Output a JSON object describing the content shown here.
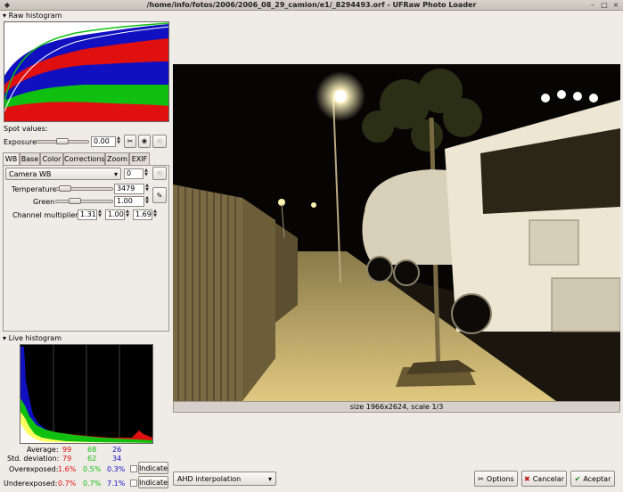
{
  "window": {
    "title": "/home/info/fotos/2006/2006_08_29_camion/e1/_8294493.orf - UFRaw Photo Loader"
  },
  "raw_histogram": {
    "label": "Raw histogram"
  },
  "spot_values": {
    "label": "Spot values:"
  },
  "exposure": {
    "label": "Exposure",
    "value": "0.00"
  },
  "tabs": [
    {
      "label": "WB"
    },
    {
      "label": "Base"
    },
    {
      "label": "Color"
    },
    {
      "label": "Corrections"
    },
    {
      "label": "Zoom"
    },
    {
      "label": "EXIF"
    }
  ],
  "wb": {
    "preset": "Camera WB",
    "fine_tune": "0",
    "temperature_label": "Temperature",
    "temperature": "3479",
    "temperature_level": 0.08,
    "green_label": "Green",
    "green": "1.00",
    "green_level": 0.3,
    "multipliers_label": "Channel multipliers:",
    "multipliers": [
      "1.31",
      "1.00",
      "1.69"
    ]
  },
  "live_histogram": {
    "label": "Live histogram",
    "average_label": "Average:",
    "average": [
      "99",
      "68",
      "26"
    ],
    "stddev_label": "Std. deviation:",
    "stddev": [
      "79",
      "62",
      "34"
    ],
    "overexposed_label": "Overexposed:",
    "overexposed": [
      "1.6%",
      "0.5%",
      "0.3%"
    ],
    "underexposed_label": "Underexposed:",
    "underexposed": [
      "0.7%",
      "0.7%",
      "7.1%"
    ],
    "indicate_label": "Indicate"
  },
  "preview": {
    "caption": "size 1966x2624, scale 1/3"
  },
  "interpolation": {
    "value": "AHD interpolation"
  },
  "buttons": {
    "options": "Options",
    "cancel": "Cancelar",
    "ok": "Aceptar"
  },
  "colors": {
    "red": "#e01010",
    "green": "#10c010",
    "blue": "#1010c0"
  }
}
